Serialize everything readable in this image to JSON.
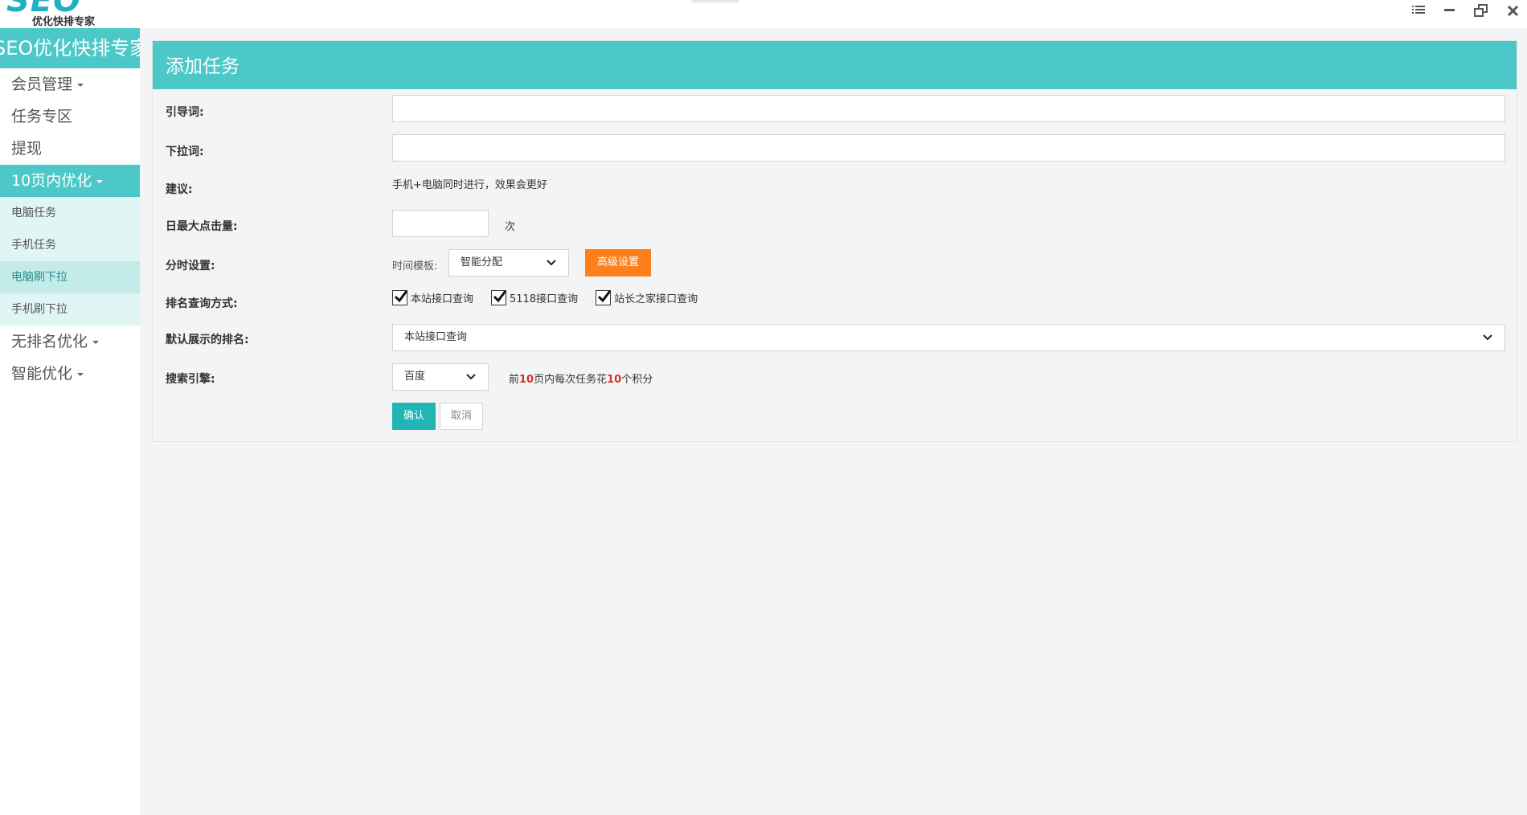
{
  "window": {
    "logo_mark": "SEO",
    "logo_sub": "优化快排专家",
    "controls": [
      "menu-icon",
      "minimize-icon",
      "restore-icon",
      "close-icon"
    ]
  },
  "sidebar": {
    "brand": "SEO优化快排专家",
    "items": [
      {
        "label": "会员管理",
        "caret": true
      },
      {
        "label": "任务专区",
        "caret": false
      },
      {
        "label": "提现",
        "caret": false
      },
      {
        "label": "10页内优化",
        "caret": true,
        "active": true
      },
      {
        "label": "电脑任务"
      },
      {
        "label": "手机任务"
      },
      {
        "label": "电脑刷下拉",
        "current": true
      },
      {
        "label": "手机刷下拉"
      },
      {
        "label": "无排名优化",
        "caret": true
      },
      {
        "label": "智能优化",
        "caret": true
      }
    ]
  },
  "form": {
    "title": "添加任务",
    "guide_word": {
      "label": "引导词:",
      "value": ""
    },
    "dropdown_word": {
      "label": "下拉词:",
      "value": ""
    },
    "suggestion": {
      "label": "建议:",
      "text": "手机+电脑同时进行，效果会更好"
    },
    "daily_clicks": {
      "label": "日最大点击量:",
      "value": "",
      "unit": "次"
    },
    "time_setting": {
      "label": "分时设置:",
      "template_label": "时间模板:",
      "template_value": "智能分配",
      "advanced_button": "高级设置"
    },
    "rank_query": {
      "label": "排名查询方式:",
      "options": [
        {
          "label": "本站接口查询",
          "checked": true
        },
        {
          "label": "5118接口查询",
          "checked": true
        },
        {
          "label": "站长之家接口查询",
          "checked": true
        }
      ]
    },
    "default_rank": {
      "label": "默认展示的排名:",
      "value": "本站接口查询"
    },
    "search_engine": {
      "label": "搜索引擎:",
      "value": "百度",
      "note_pre": "前",
      "note_pages": "10",
      "note_mid": "页内每次任务花",
      "note_points": "10",
      "note_post": "个积分"
    },
    "confirm_button": "确认",
    "cancel_button": "取消"
  },
  "colors": {
    "accent": "#4dc8c8",
    "submenu_bg": "#e0f6f5",
    "orange": "#ff7f1a",
    "confirm": "#21b5b5",
    "highlight": "#d9312b"
  }
}
